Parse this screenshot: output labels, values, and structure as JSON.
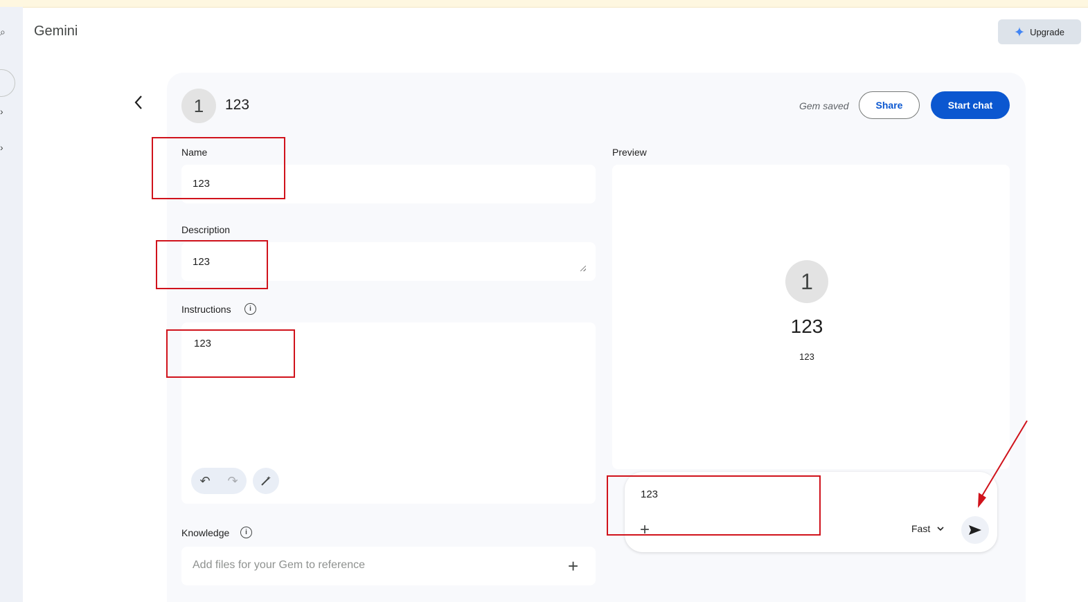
{
  "app": {
    "title": "Gemini"
  },
  "header": {
    "upgrade_label": "Upgrade",
    "gem_avatar_letter": "1",
    "gem_name": "123",
    "saved_status": "Gem saved",
    "share_label": "Share",
    "start_chat_label": "Start chat"
  },
  "form": {
    "name_label": "Name",
    "name_value": "123",
    "description_label": "Description",
    "description_value": "123",
    "instructions_label": "Instructions",
    "instructions_value": "123",
    "knowledge_label": "Knowledge",
    "knowledge_placeholder": "Add files for your Gem to reference"
  },
  "preview": {
    "label": "Preview",
    "avatar_letter": "1",
    "name": "123",
    "description": "123",
    "chat_input_value": "123",
    "mode_label": "Fast"
  },
  "icons": {
    "back": "chevron-left-icon",
    "info": "info-icon",
    "undo": "undo-icon",
    "redo": "redo-icon",
    "magic": "magic-wand-icon",
    "plus": "plus-icon",
    "send": "send-icon",
    "chevron_down": "chevron-down-icon",
    "sparkle": "sparkle-icon"
  },
  "colors": {
    "primary": "#0b57d0",
    "annotation": "#d0121b"
  }
}
